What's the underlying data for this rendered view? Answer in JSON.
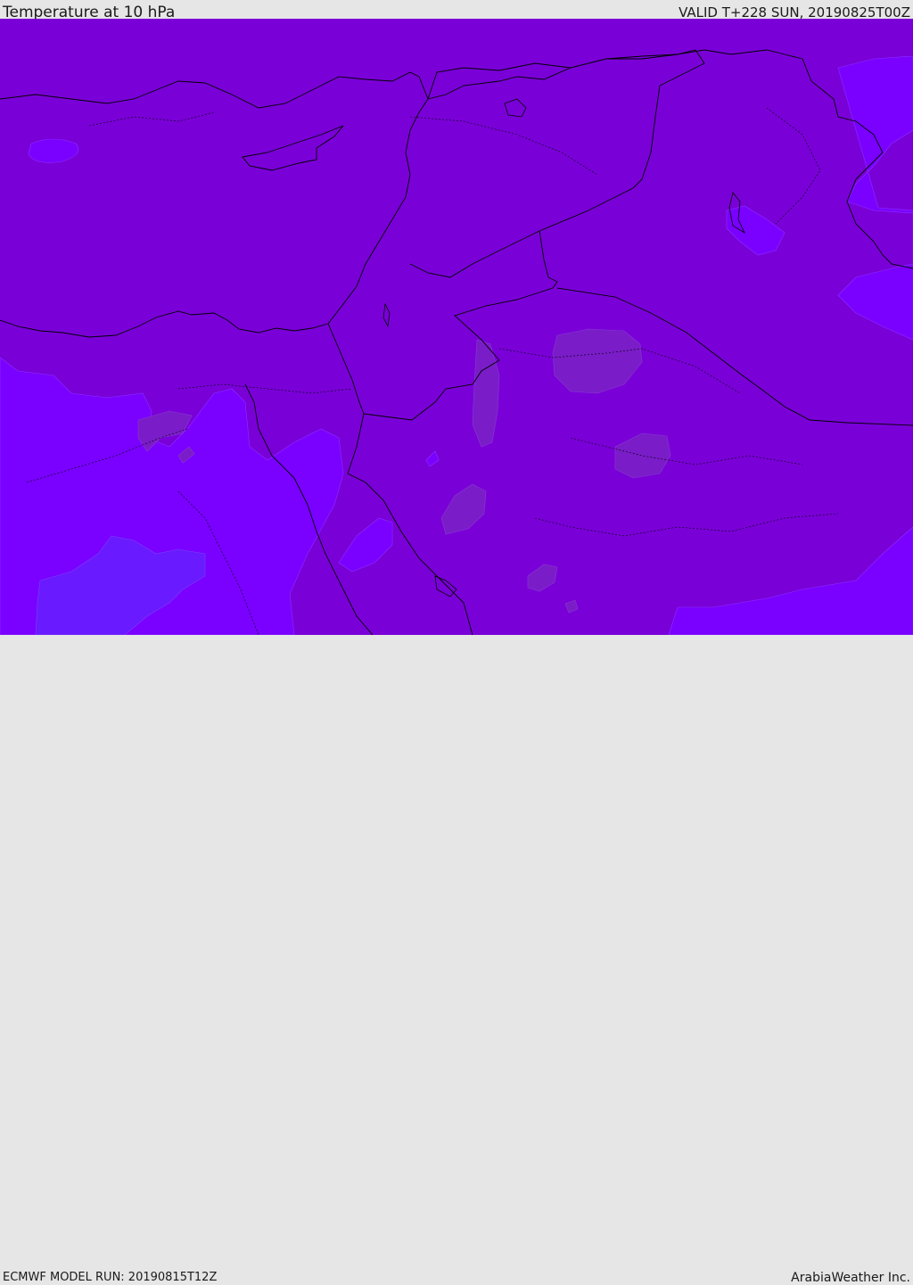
{
  "header": {
    "title": "Temperature at 10 hPa",
    "valid_time": "VALID T+228 SUN, 20190825T00Z"
  },
  "footer": {
    "model_run": "ECMWF MODEL RUN: 20190815T12Z",
    "brand": "ArabiaWeather Inc."
  },
  "map": {
    "colors": {
      "base": "#7a00d8",
      "cooler": "#7a00ff",
      "coldest": "#6a1aff",
      "warmer": "#7a1cc8",
      "border": "#000000"
    }
  }
}
